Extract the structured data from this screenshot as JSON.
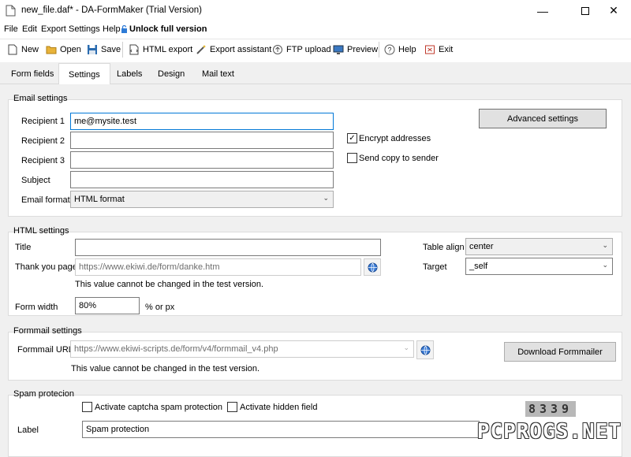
{
  "window": {
    "title": "new_file.daf* - DA-FormMaker (Trial Version)"
  },
  "menu": {
    "file": "File",
    "edit": "Edit",
    "export": "Export",
    "settings": "Settings",
    "help": "Help",
    "unlock": "Unlock full version"
  },
  "toolbar": {
    "new": "New",
    "open": "Open",
    "save": "Save",
    "html_export": "HTML export",
    "export_assistant": "Export assistant",
    "ftp_upload": "FTP upload",
    "preview": "Preview",
    "help": "Help",
    "exit": "Exit"
  },
  "tabs": [
    "Form fields",
    "Settings",
    "Labels",
    "Design",
    "Mail text"
  ],
  "email": {
    "group": "Email settings",
    "recipient1_label": "Recipient 1",
    "recipient1_value": "me@mysite.test",
    "recipient2_label": "Recipient 2",
    "recipient2_value": "",
    "recipient3_label": "Recipient 3",
    "recipient3_value": "",
    "subject_label": "Subject",
    "subject_value": "",
    "format_label": "Email format",
    "format_value": "HTML format",
    "encrypt_label": "Encrypt addresses",
    "encrypt_checked": true,
    "sendcopy_label": "Send copy to sender",
    "sendcopy_checked": false,
    "advanced_button": "Advanced settings"
  },
  "html": {
    "group": "HTML settings",
    "title_label": "Title",
    "title_value": "",
    "thankyou_label": "Thank you page",
    "thankyou_value": "https://www.ekiwi.de/form/danke.htm",
    "note": "This value cannot be changed in the test version.",
    "formwidth_label": "Form width",
    "formwidth_value": "80%",
    "formwidth_unit": "% or px",
    "tablealign_label": "Table align",
    "tablealign_value": "center",
    "target_label": "Target",
    "target_value": "_self"
  },
  "formmail": {
    "group": "Formmail settings",
    "url_label": "Formmail URL",
    "url_value": "https://www.ekiwi-scripts.de/form/v4/formmail_v4.php",
    "note": "This value cannot be changed in the test version.",
    "download_button": "Download Formmailer"
  },
  "spam": {
    "group": "Spam protecion",
    "captcha_label": "Activate captcha spam protection",
    "captcha_checked": false,
    "hidden_label": "Activate hidden field",
    "hidden_checked": false,
    "label_label": "Label",
    "label_value": "Spam protection",
    "captcha_image": "8339"
  },
  "watermark": "PCPROGS.NET"
}
